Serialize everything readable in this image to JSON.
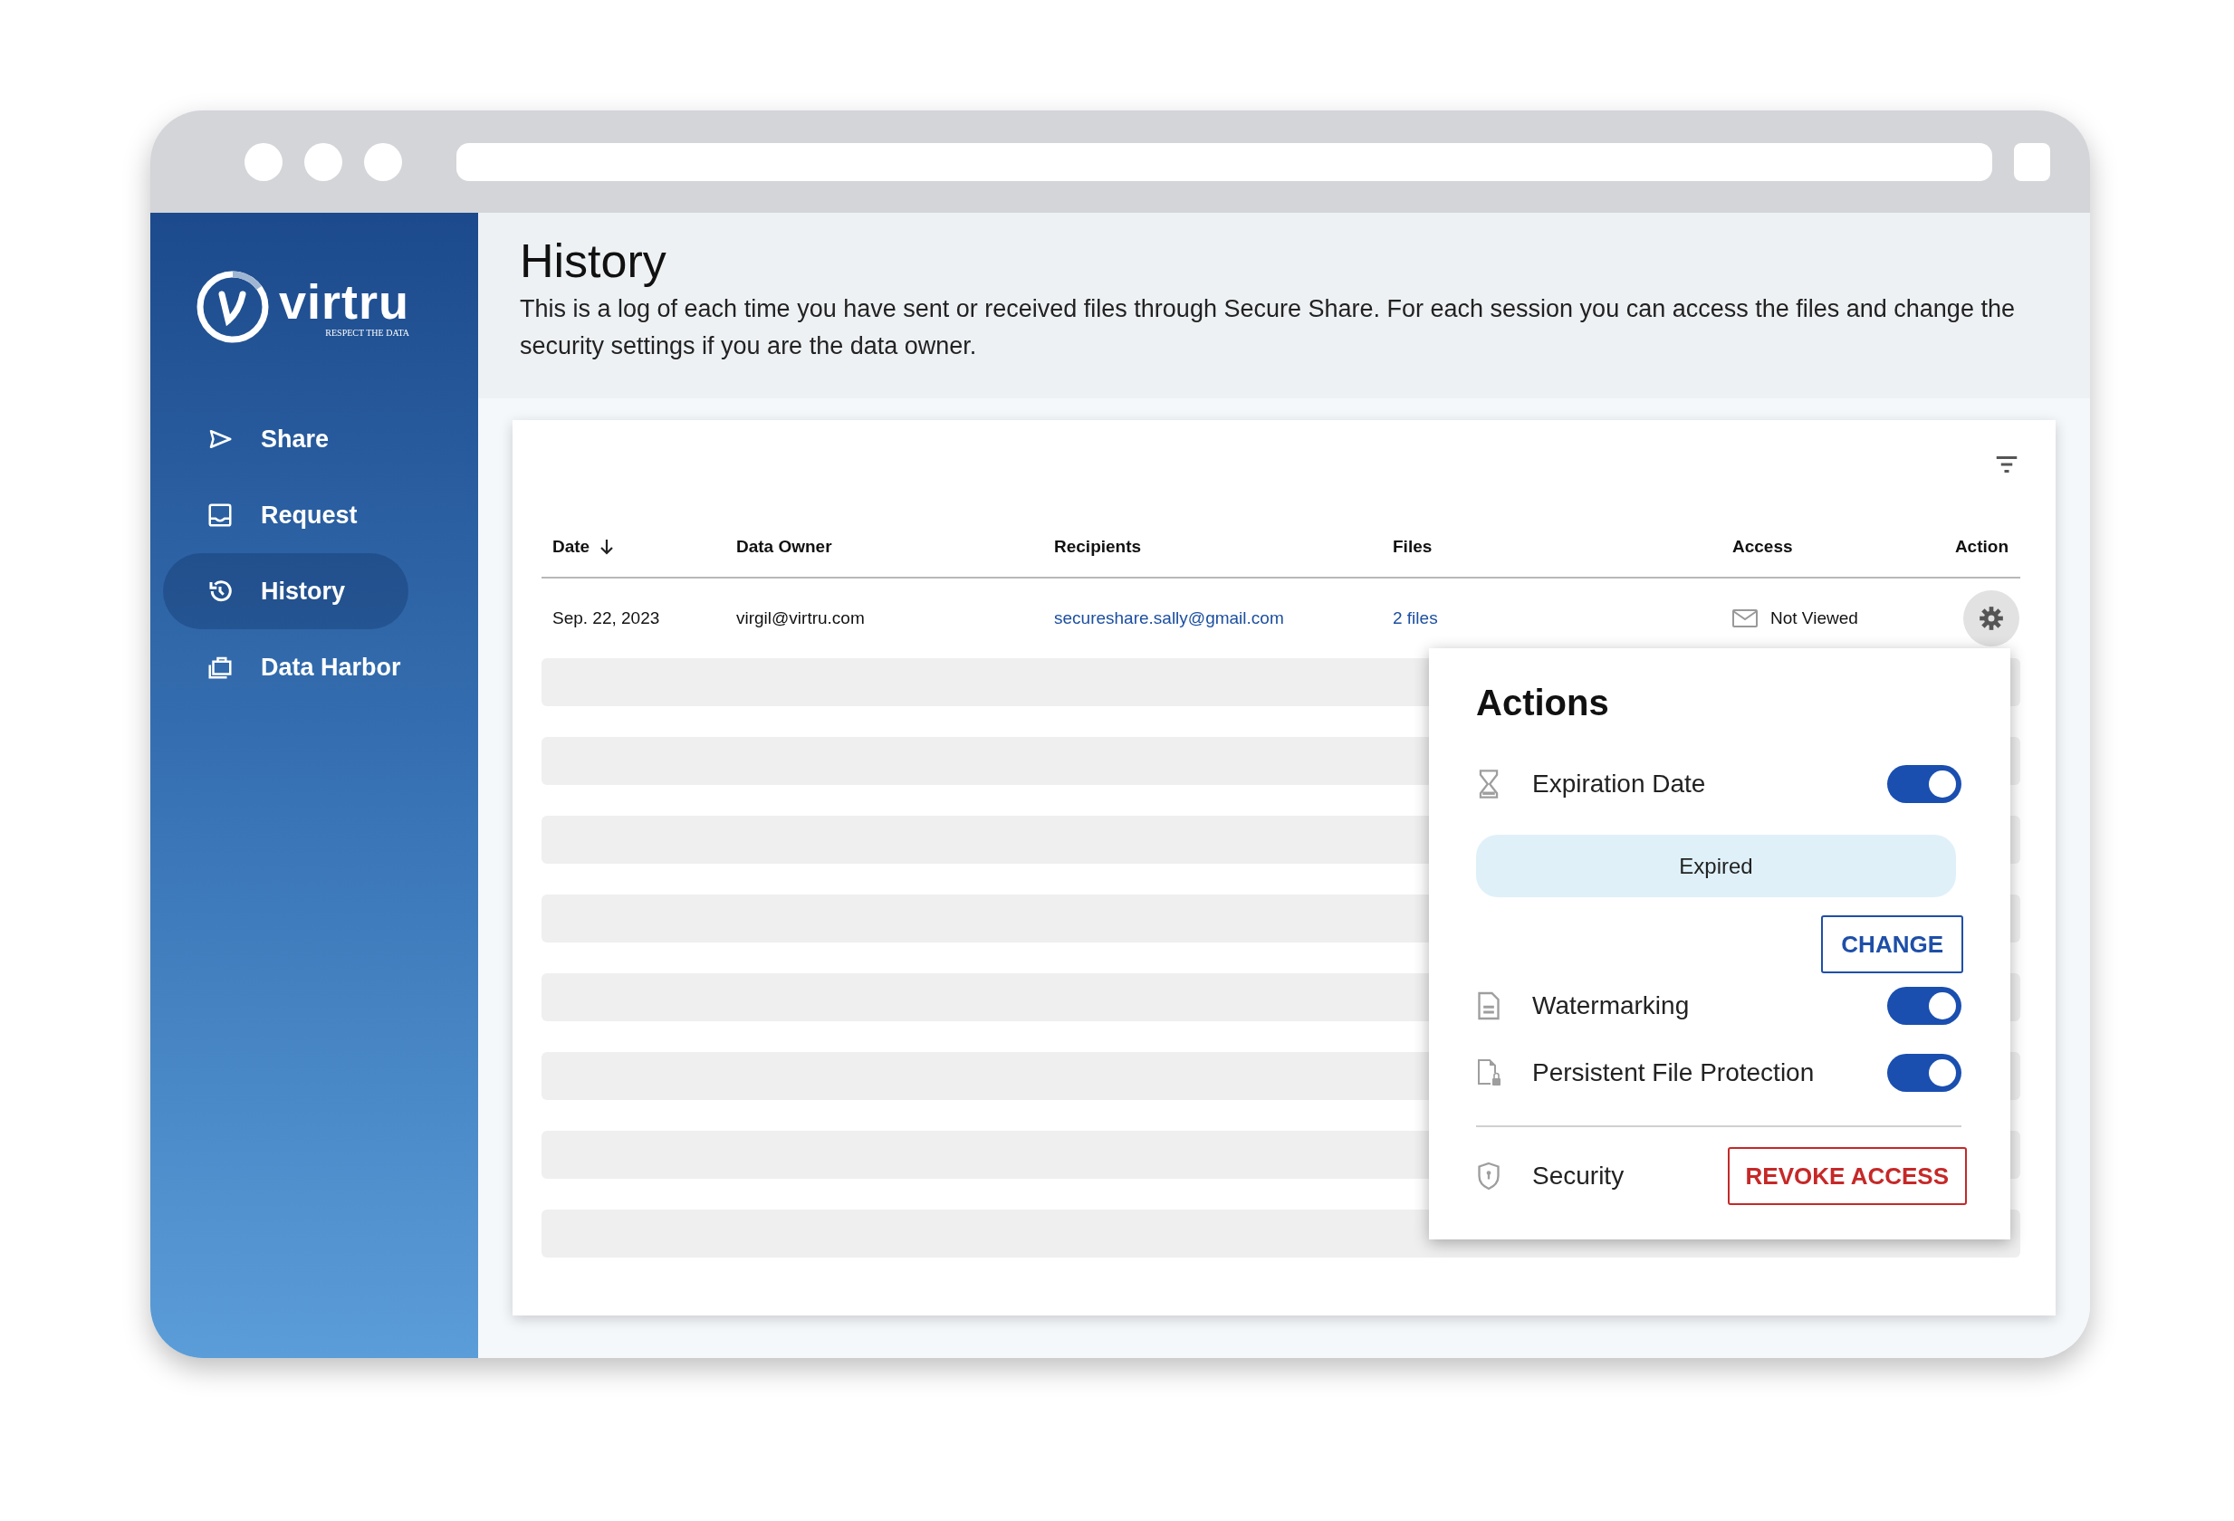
{
  "logo": {
    "wordmark": "virtru",
    "tagline": "RESPECT THE DATA"
  },
  "sidebar": {
    "items": [
      {
        "kind": "share",
        "label": "Share",
        "selected": false
      },
      {
        "kind": "request",
        "label": "Request",
        "selected": false
      },
      {
        "kind": "history",
        "label": "History",
        "selected": true
      },
      {
        "kind": "harbor",
        "label": "Data Harbor",
        "selected": false
      }
    ]
  },
  "page": {
    "title": "History",
    "description": "This is a log of each time you have sent or received files through Secure Share. For each session you can access the files and change the security settings if you are the data owner."
  },
  "table": {
    "columns": [
      {
        "label": "Date",
        "sorted": true
      },
      {
        "label": "Data Owner",
        "sorted": false
      },
      {
        "label": "Recipients",
        "sorted": false
      },
      {
        "label": "Files",
        "sorted": false
      },
      {
        "label": "Access",
        "sorted": false
      },
      {
        "label": "Action",
        "sorted": false
      }
    ],
    "rows": [
      {
        "date": "Sep. 22, 2023",
        "data_owner": "virgil@virtru.com",
        "recipients": "secureshare.sally@gmail.com",
        "files": "2 files",
        "access": "Not Viewed"
      }
    ]
  },
  "actions_menu": {
    "title": "Actions",
    "expiration": {
      "label": "Expiration Date",
      "on": true,
      "status": "Expired",
      "button": "CHANGE"
    },
    "toggles": [
      {
        "kind": "watermark",
        "label": "Watermarking",
        "on": true
      },
      {
        "kind": "protection",
        "label": "Persistent File Protection",
        "on": true
      }
    ],
    "security": {
      "label": "Security",
      "button": "REVOKE ACCESS"
    }
  }
}
